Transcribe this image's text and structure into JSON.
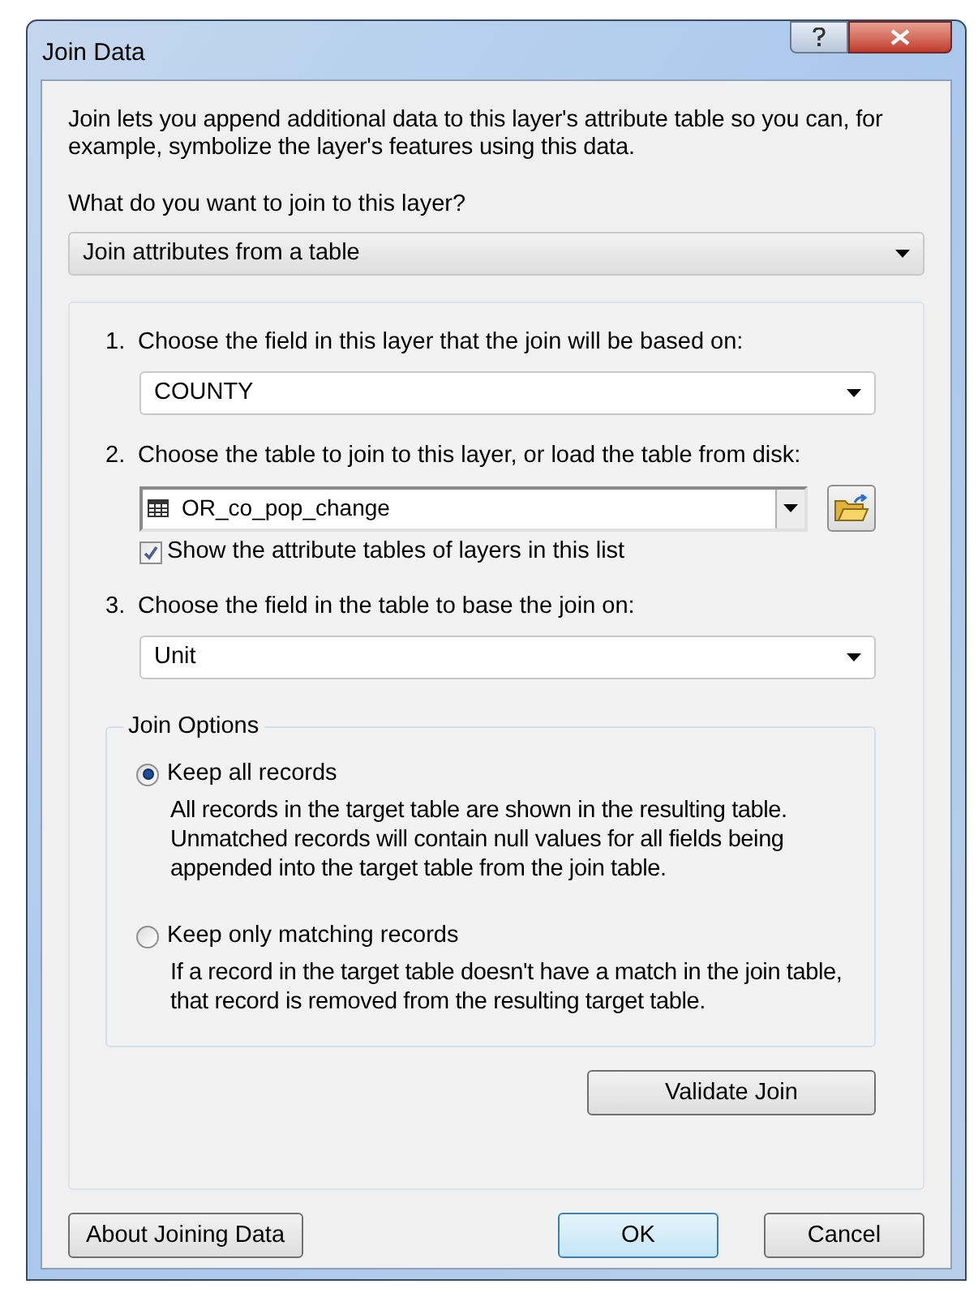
{
  "window": {
    "title": "Join Data"
  },
  "intro": "Join lets you append additional data to this layer's attribute table so you can, for example, symbolize the layer's features using this data.",
  "join_type": {
    "label": "What do you want to join to this layer?",
    "value": "Join attributes from a table"
  },
  "steps": [
    {
      "kind": "dropdown",
      "number": "1.",
      "label": "Choose the field in this layer that the join will be based on:",
      "value": "COUNTY"
    },
    {
      "kind": "table_picker",
      "number": "2.",
      "label": "Choose the table to join to this layer, or load the table from disk:",
      "value": "OR_co_pop_change",
      "checkbox": {
        "label": "Show the attribute tables of layers in this list",
        "checked": true
      }
    },
    {
      "kind": "dropdown",
      "number": "3.",
      "label": "Choose the field in the table to base the join on:",
      "value": "Unit"
    }
  ],
  "join_options": {
    "legend": "Join Options",
    "options": [
      {
        "label": "Keep all records",
        "description": "All records in the target table are shown in the resulting table. Unmatched records will contain null values for all fields being appended into the target table from the join table.",
        "selected": true
      },
      {
        "label": "Keep only matching records",
        "description": "If a record in the target table doesn't have a match in the join table, that record is removed from the resulting target table.",
        "selected": false
      }
    ]
  },
  "validate_button": "Validate Join",
  "footer_left_buttons": [
    {
      "label": "About Joining Data",
      "default": false
    }
  ],
  "footer_right_buttons": [
    {
      "label": "OK",
      "default": true
    },
    {
      "label": "Cancel",
      "default": false
    }
  ]
}
